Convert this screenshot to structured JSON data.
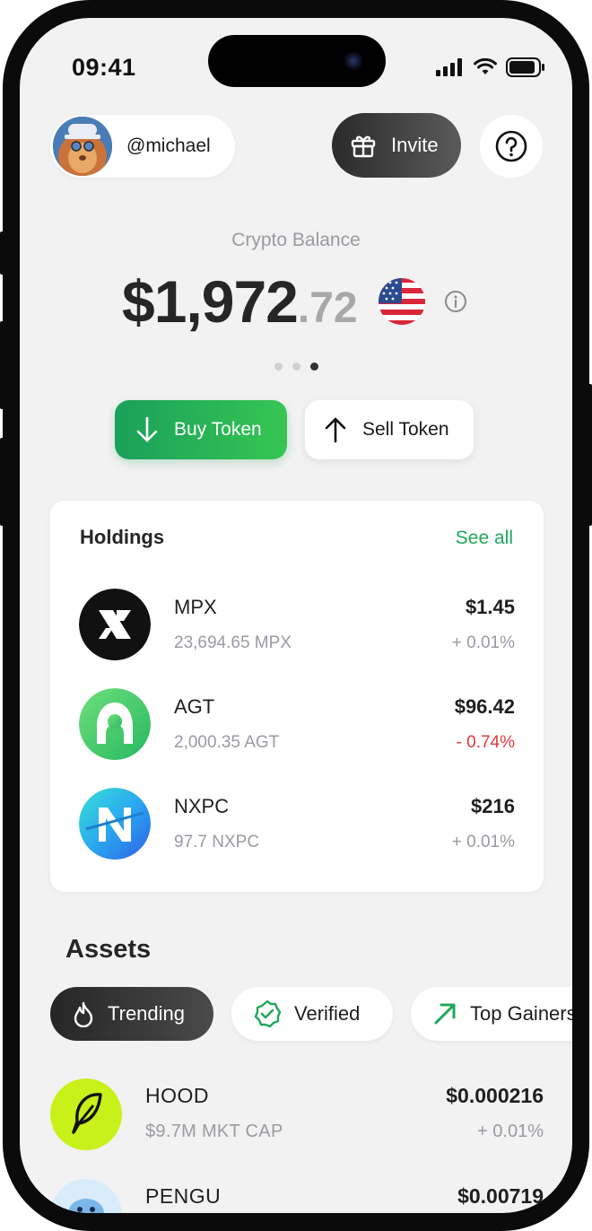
{
  "status": {
    "time": "09:41"
  },
  "header": {
    "username": "@michael",
    "invite_label": "Invite"
  },
  "balance": {
    "label": "Crypto Balance",
    "main": "$1,972",
    "cents": ".72",
    "currency_flag": "us-flag-icon",
    "carousel_pages": 3,
    "carousel_active": 3
  },
  "actions": {
    "buy_label": "Buy Token",
    "sell_label": "Sell Token"
  },
  "holdings": {
    "title": "Holdings",
    "see_all": "See all",
    "items": [
      {
        "name": "MPX",
        "amount": "23,694.65 MPX",
        "price": "$1.45",
        "change": "+ 0.01%",
        "direction": "up"
      },
      {
        "name": "AGT",
        "amount": "2,000.35 AGT",
        "price": "$96.42",
        "change": "- 0.74%",
        "direction": "down"
      },
      {
        "name": "NXPC",
        "amount": "97.7 NXPC",
        "price": "$216",
        "change": "+ 0.01%",
        "direction": "up"
      }
    ]
  },
  "assets": {
    "title": "Assets",
    "filters": [
      "Trending",
      "Verified",
      "Top Gainers"
    ],
    "active_filter": "Trending",
    "items": [
      {
        "name": "HOOD",
        "cap": "$9.7M MKT CAP",
        "price": "$0.000216",
        "change": "+ 0.01%"
      },
      {
        "name": "PENGU",
        "cap": "",
        "price": "$0.00719",
        "change": ""
      }
    ]
  },
  "colors": {
    "accent_green": "#1fa85a",
    "negative_red": "#e03a3a",
    "muted_text": "#9a9aa2"
  }
}
